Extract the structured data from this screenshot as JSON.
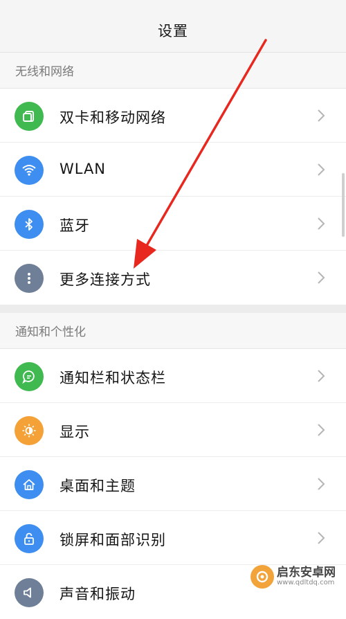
{
  "header": {
    "title": "设置"
  },
  "sections": [
    {
      "title": "无线和网络",
      "items": [
        {
          "label": "双卡和移动网络",
          "icon": "sim-card-icon",
          "color": "#3fb950"
        },
        {
          "label": "WLAN",
          "icon": "wifi-icon",
          "color": "#3d8ef0"
        },
        {
          "label": "蓝牙",
          "icon": "bluetooth-icon",
          "color": "#3d8ef0"
        },
        {
          "label": "更多连接方式",
          "icon": "more-dots-icon",
          "color": "#6f7f98"
        }
      ]
    },
    {
      "title": "通知和个性化",
      "items": [
        {
          "label": "通知栏和状态栏",
          "icon": "chat-bubble-icon",
          "color": "#3fb950"
        },
        {
          "label": "显示",
          "icon": "brightness-icon",
          "color": "#f4a237"
        },
        {
          "label": "桌面和主题",
          "icon": "home-icon",
          "color": "#3d8ef0"
        },
        {
          "label": "锁屏和面部识别",
          "icon": "lock-icon",
          "color": "#3d8ef0"
        },
        {
          "label": "声音和振动",
          "icon": "speaker-icon",
          "color": "#6f7f98"
        }
      ]
    }
  ],
  "watermark": {
    "name": "启东安卓网",
    "url": "www.qdltdq.com"
  },
  "annotation": {
    "color": "#e8281f"
  }
}
